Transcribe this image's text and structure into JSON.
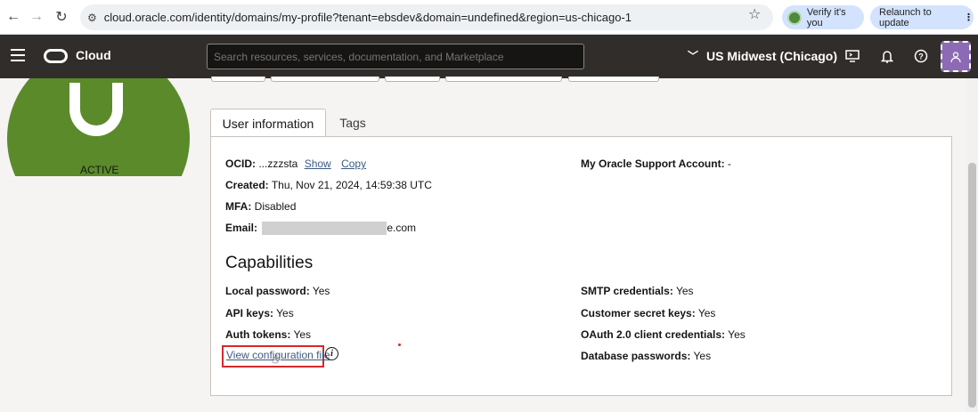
{
  "browser": {
    "url": "cloud.oracle.com/identity/domains/my-profile?tenant=ebsdev&domain=undefined&region=us-chicago-1",
    "verify_label": "Verify it's you",
    "relaunch_label": "Relaunch to update"
  },
  "header": {
    "brand": "Cloud",
    "search_placeholder": "Search resources, services, documentation, and Marketplace",
    "region": "US Midwest (Chicago)"
  },
  "profile": {
    "status": "ACTIVE"
  },
  "tabs": [
    {
      "label": "User information"
    },
    {
      "label": "Tags"
    }
  ],
  "user_info": {
    "ocid_label": "OCID:",
    "ocid_value": "...zzzsta",
    "show_link": "Show",
    "copy_link": "Copy",
    "created_label": "Created:",
    "created_value": "Thu, Nov 21, 2024, 14:59:38 UTC",
    "mfa_label": "MFA:",
    "mfa_value": "Disabled",
    "email_label": "Email:",
    "email_suffix": "e.com",
    "support_label": "My Oracle Support Account:",
    "support_value": "-"
  },
  "capabilities": {
    "title": "Capabilities",
    "local_password_label": "Local password:",
    "local_password_value": "Yes",
    "api_keys_label": "API keys:",
    "api_keys_value": "Yes",
    "auth_tokens_label": "Auth tokens:",
    "auth_tokens_value": "Yes",
    "view_config_link": "View configuration file",
    "smtp_label": "SMTP credentials:",
    "smtp_value": "Yes",
    "customer_secret_label": "Customer secret keys:",
    "customer_secret_value": "Yes",
    "oauth_label": "OAuth 2.0 client credentials:",
    "oauth_value": "Yes",
    "db_passwords_label": "Database passwords:",
    "db_passwords_value": "Yes"
  },
  "colors": {
    "header_bg": "#312d2a",
    "active_green": "#5b8a2b",
    "highlight_red": "#d6282c"
  }
}
